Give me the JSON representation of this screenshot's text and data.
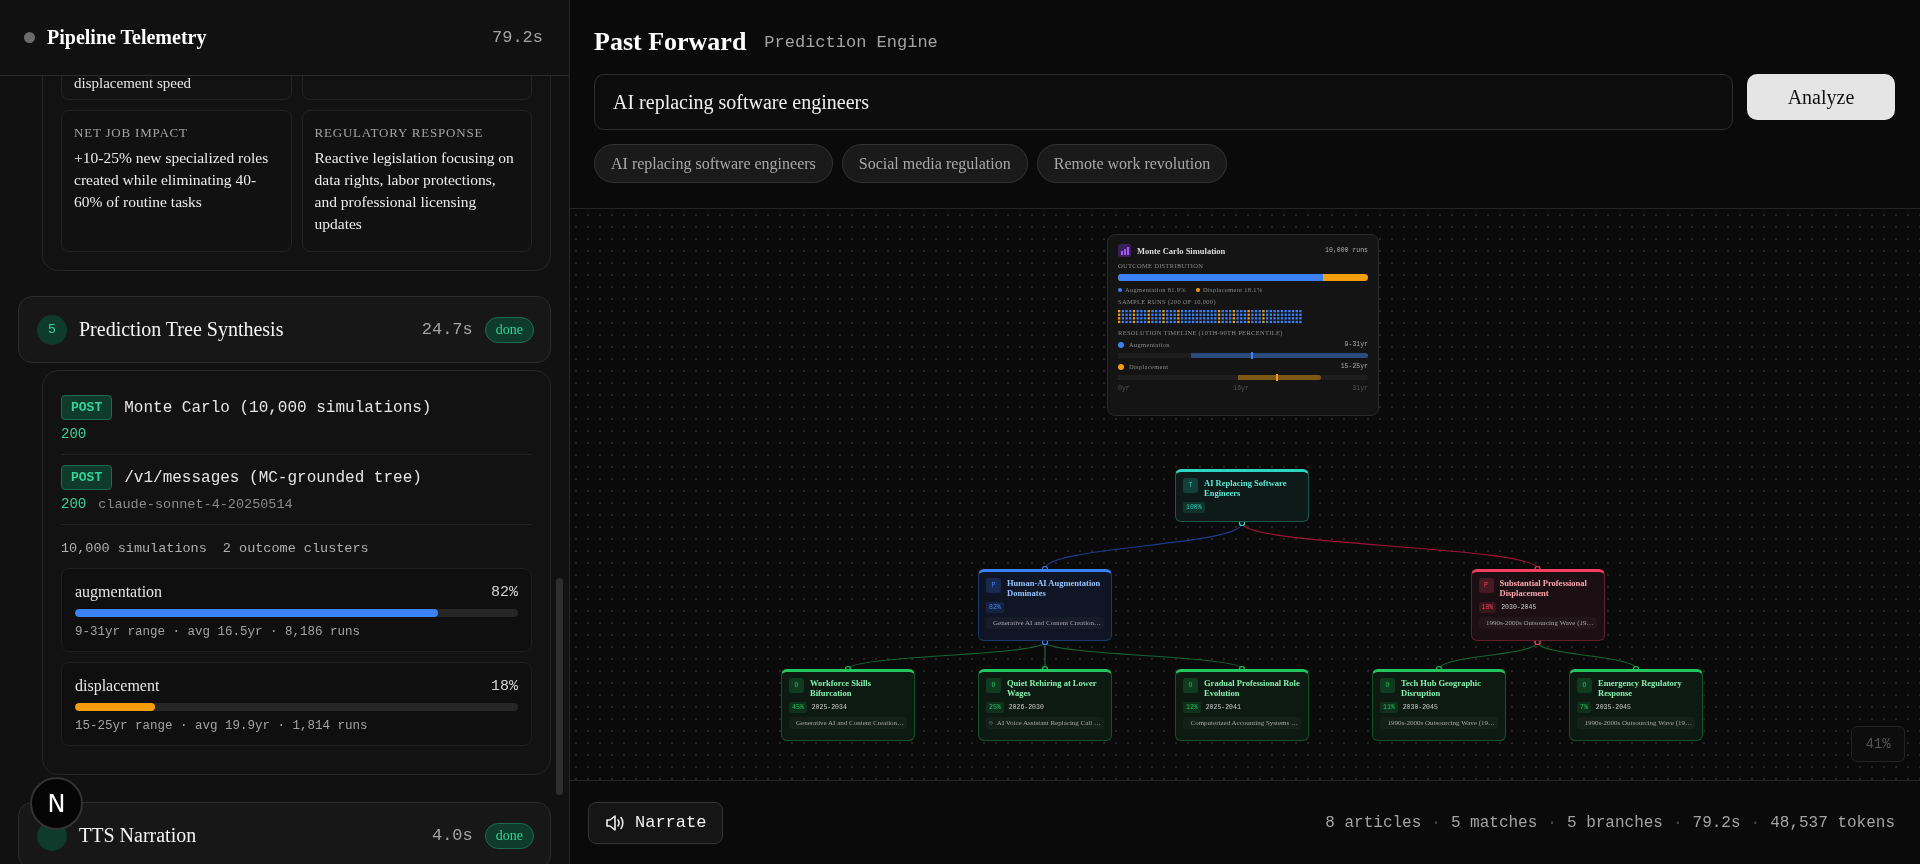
{
  "telemetry": {
    "title": "Pipeline Telemetry",
    "elapsed": "79.2s",
    "active": false
  },
  "partial_row": {
    "left": "displacement speed"
  },
  "insights": [
    {
      "label": "NET JOB IMPACT",
      "text": "+10-25% new specialized roles created while eliminating 40-60% of routine tasks"
    },
    {
      "label": "REGULATORY RESPONSE",
      "text": "Reactive legislation focusing on data rights, labor protections, and professional licensing updates"
    }
  ],
  "steps": [
    {
      "number": "5",
      "title": "Prediction Tree Synthesis",
      "time": "24.7s",
      "status": "done",
      "calls": [
        {
          "method": "POST",
          "endpoint": "Monte Carlo (10,000 simulations)",
          "status": "200"
        },
        {
          "method": "POST",
          "endpoint": "/v1/messages (MC-grounded tree)",
          "status": "200",
          "model": "claude-sonnet-4-20250514"
        }
      ],
      "summary": [
        "10,000 simulations",
        "2 outcome clusters"
      ],
      "clusters": [
        {
          "name": "augmentation",
          "percent": "82%",
          "level": 0.82,
          "color": "#3b82f6",
          "detail": "9-31yr range · avg 16.5yr · 8,186 runs"
        },
        {
          "name": "displacement",
          "percent": "18%",
          "level": 0.18,
          "color": "#f59e0b",
          "detail": "15-25yr range · avg 19.9yr · 1,814 runs"
        }
      ]
    },
    {
      "title": "TTS Narration",
      "time": "4.0s",
      "status": "done"
    }
  ],
  "dev_badge": {
    "letter": "N"
  },
  "header": {
    "title": "Past Forward",
    "subtitle": "Prediction Engine"
  },
  "query": {
    "value": "AI replacing software engineers"
  },
  "analyze": "Analyze",
  "suggestions": [
    "AI replacing software engineers",
    "Social media regulation",
    "Remote work revolution"
  ],
  "monte_carlo": {
    "title": "Monte Carlo Simulation",
    "runs": "10,000 runs",
    "distribution_label": "OUTCOME DISTRIBUTION",
    "distribution": {
      "level": 0.819
    },
    "legend": [
      {
        "label": "Augmentation 81.9%",
        "color": "#3b82f6"
      },
      {
        "label": "Displacement 18.1%",
        "color": "#f59e0b"
      }
    ],
    "samples_label": "SAMPLE RUNS (200 OF 10,000)",
    "timeline_label": "RESOLUTION TIMELINE (10TH-90TH PERCENTILE)",
    "timeline": [
      {
        "name": "Augmentation",
        "range": "9-31yr",
        "color": "#3b82f6",
        "start": {
          "level": 0.29
        },
        "end": {
          "level": 1
        },
        "median": {
          "level": 0.53
        }
      },
      {
        "name": "Displacement",
        "range": "15-25yr",
        "color": "#f59e0b",
        "start": {
          "level": 0.48
        },
        "end": {
          "level": 0.81
        },
        "median": {
          "level": 0.63
        }
      }
    ],
    "axis": [
      "0yr",
      "16yr",
      "31yr"
    ]
  },
  "tree": {
    "kind": "root",
    "badge": "T",
    "title": "AI Replacing Software Engineers",
    "probability": "100%",
    "children": [
      {
        "kind": "positive",
        "badge": "P",
        "title": "Human-AI Augmentation Dominates",
        "probability": "82%",
        "source": "Generative AI and Content Creation…",
        "children": [
          {
            "kind": "outcome",
            "badge": "O",
            "title": "Workforce Skills Bifurcation",
            "probability": "45%",
            "years": "2025-2034",
            "source": "Generative AI and Content Creation…"
          },
          {
            "kind": "outcome",
            "badge": "O",
            "title": "Quiet Rehiring at Lower Wages",
            "probability": "25%",
            "years": "2026-2030",
            "source": "AI Voice Assistant Replacing Call …"
          },
          {
            "kind": "outcome",
            "badge": "O",
            "title": "Gradual Professional Role Evolution",
            "probability": "12%",
            "years": "2025-2041",
            "source": "Computerized Accounting Systems …"
          }
        ]
      },
      {
        "kind": "negative",
        "badge": "P",
        "title": "Substantial Professional Displacement",
        "probability": "18%",
        "years": "2030-2045",
        "source": "1990s-2000s Outsourcing Wave (19…",
        "children": [
          {
            "kind": "outcome",
            "badge": "O",
            "title": "Tech Hub Geographic Disruption",
            "probability": "11%",
            "years": "2030-2045",
            "source": "1990s-2000s Outsourcing Wave (19…"
          },
          {
            "kind": "outcome",
            "badge": "O",
            "title": "Emergency Regulatory Response",
            "probability": "7%",
            "years": "2035-2045",
            "source": "1990s-2000s Outsourcing Wave (19…"
          }
        ]
      }
    ]
  },
  "zoom": "41%",
  "footer": {
    "narrate": "Narrate",
    "separator": "·",
    "stats": [
      "8 articles",
      "5 matches",
      "5 branches",
      "79.2s",
      "48,537 tokens"
    ]
  }
}
